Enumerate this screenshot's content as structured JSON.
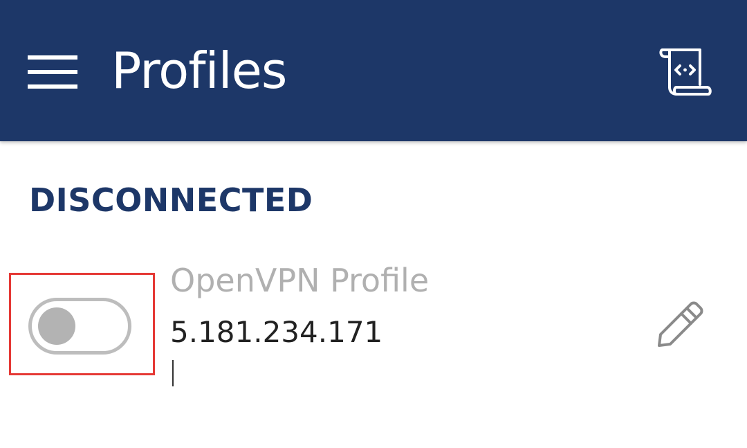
{
  "toolbar": {
    "title": "Profiles",
    "menu_icon": "hamburger-menu-icon",
    "log_icon": "code-scroll-icon",
    "background_color": "#1d3768"
  },
  "status": {
    "label": "DISCONNECTED",
    "color": "#1d3768"
  },
  "profiles": [
    {
      "name": "OpenVPN Profile",
      "server": "5.181.234.171",
      "toggle_state": "off",
      "edit_icon": "pencil-icon"
    }
  ],
  "highlight_color": "#e53935"
}
